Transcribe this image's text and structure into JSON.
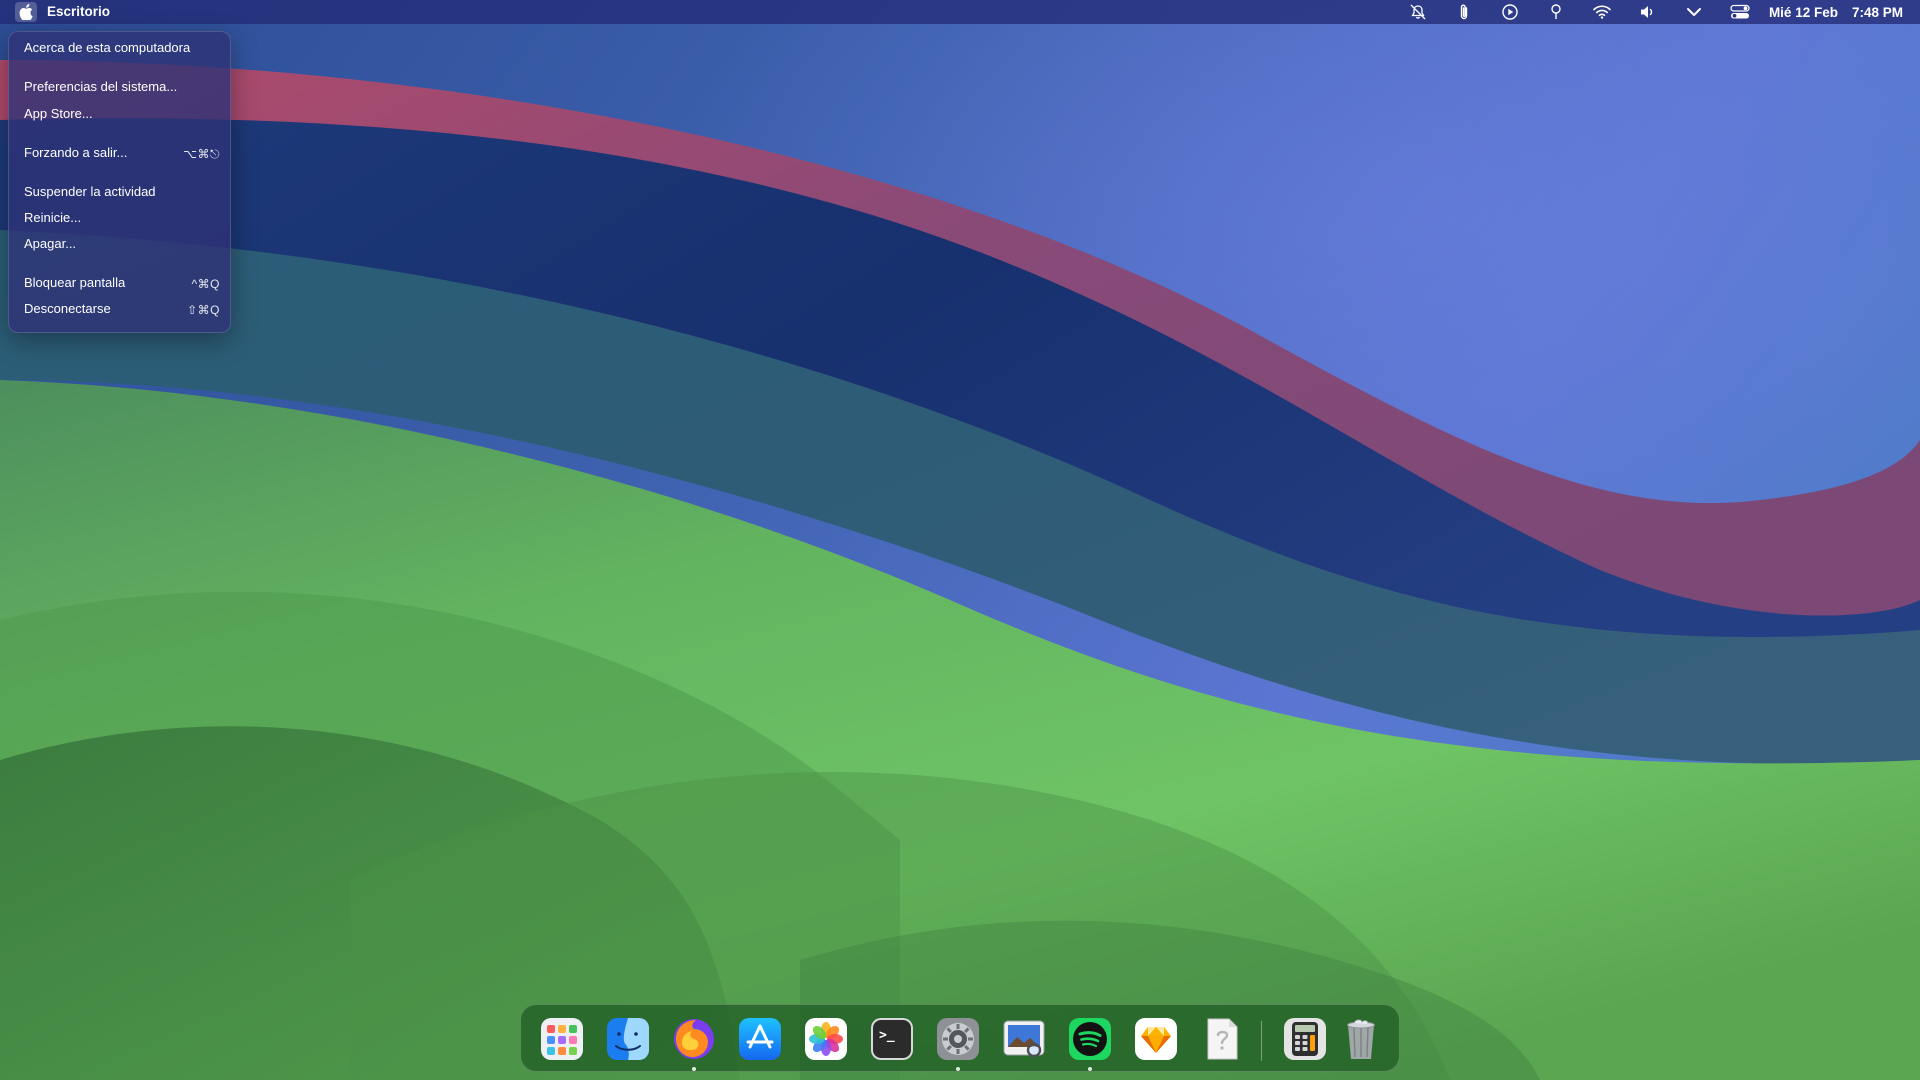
{
  "menubar": {
    "app_name": "Escritorio",
    "status_icons": [
      "no-bell-icon",
      "paperclip-icon",
      "play-circle-icon",
      "location-pin-icon",
      "wifi-icon",
      "volume-icon",
      "chevron-down-icon",
      "control-center-icon"
    ],
    "date": "Mié 12 Feb",
    "time": "7:48 PM"
  },
  "apple_menu": {
    "items": [
      {
        "label": "Acerca de esta computadora",
        "shortcut": ""
      },
      {
        "label": "Preferencias del sistema...",
        "shortcut": ""
      },
      {
        "label": "App Store...",
        "shortcut": ""
      },
      {
        "label": "Forzando a salir...",
        "shortcut": "⌥⌘⎋"
      },
      {
        "label": "Suspender la actividad",
        "shortcut": ""
      },
      {
        "label": "Reinicie...",
        "shortcut": ""
      },
      {
        "label": "Apagar...",
        "shortcut": ""
      },
      {
        "label": "Bloquear pantalla",
        "shortcut": "^⌘Q"
      },
      {
        "label": "Desconectarse",
        "shortcut": "⇧⌘Q"
      }
    ]
  },
  "dock": {
    "apps": [
      {
        "icon": "launchpad-icon",
        "running": false
      },
      {
        "icon": "finder-icon",
        "running": false
      },
      {
        "icon": "firefox-icon",
        "running": true
      },
      {
        "icon": "app-store-icon",
        "running": false
      },
      {
        "icon": "photos-icon",
        "running": false
      },
      {
        "icon": "terminal-icon",
        "running": false
      },
      {
        "icon": "system-preferences-icon",
        "running": true
      },
      {
        "icon": "preview-icon",
        "running": false
      },
      {
        "icon": "spotify-icon",
        "running": true
      },
      {
        "icon": "sketch-icon",
        "running": false
      },
      {
        "icon": "generic-document-icon",
        "running": false
      },
      {
        "icon": "calculator-icon",
        "running": false
      },
      {
        "icon": "trash-icon",
        "running": false
      }
    ],
    "terminal_prompt": ">_"
  },
  "colors": {
    "menubar": "#222c76",
    "menu_bg": "#2e3276",
    "dock_bg": "#1e5a22",
    "wallpaper_green": "#6ac466",
    "wallpaper_blue": "#3d63a8",
    "wallpaper_navy": "#1c3574",
    "wallpaper_pink": "#9a4a6e"
  }
}
